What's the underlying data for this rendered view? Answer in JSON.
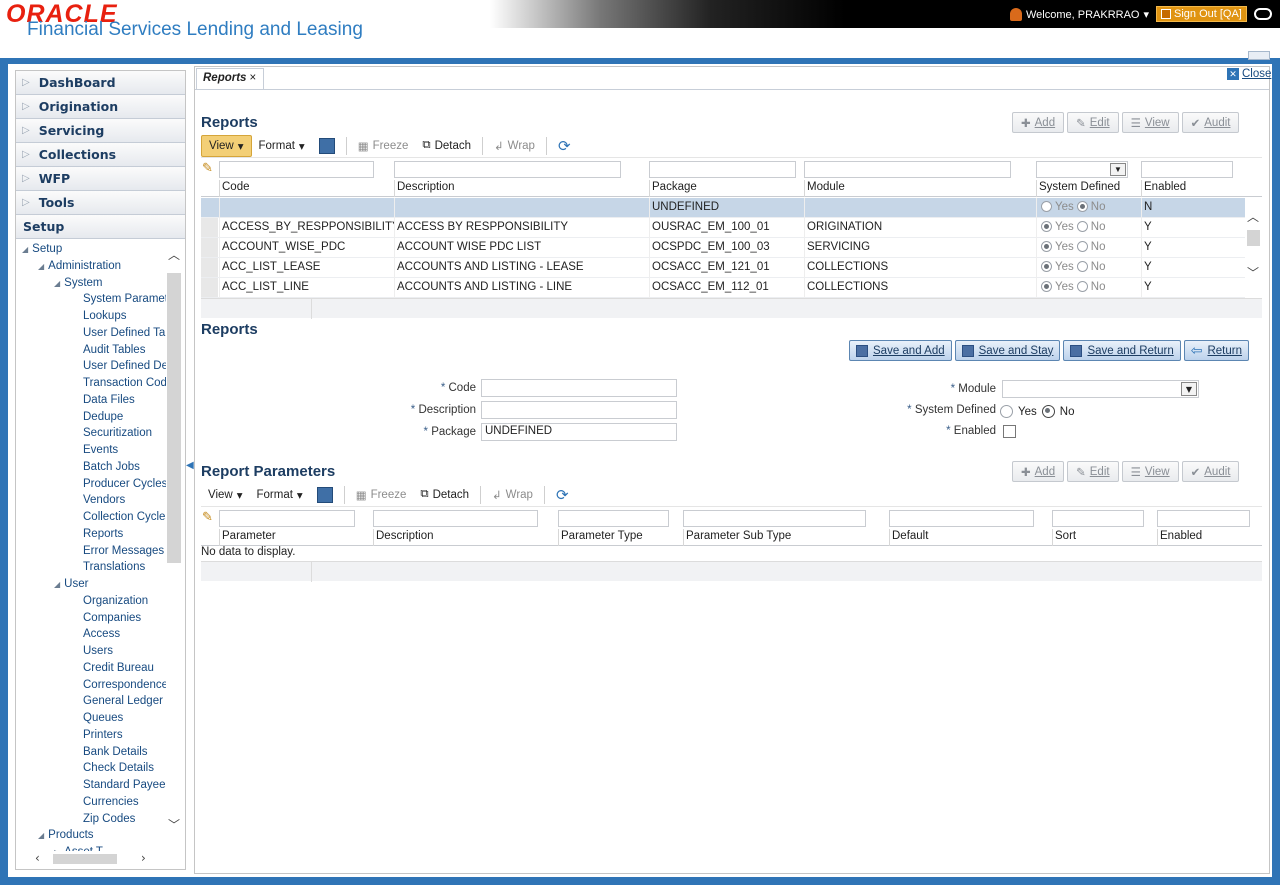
{
  "header": {
    "logo": "ORACLE",
    "product": "Financial Services Lending and Leasing",
    "welcome": "Welcome, PRAKRRAO",
    "signout": "Sign Out [QA]"
  },
  "sidebar": {
    "accordions": [
      "DashBoard",
      "Origination",
      "Servicing",
      "Collections",
      "WFP",
      "Tools"
    ],
    "active_accordion": "Setup",
    "tree": [
      {
        "label": "Setup",
        "level": 0,
        "expanded": true
      },
      {
        "label": "Administration",
        "level": 1,
        "expanded": true
      },
      {
        "label": "System",
        "level": 2,
        "expanded": true
      },
      {
        "label": "System Paramete",
        "level": 3
      },
      {
        "label": "Lookups",
        "level": 3
      },
      {
        "label": "User Defined Tab",
        "level": 3
      },
      {
        "label": "Audit Tables",
        "level": 3
      },
      {
        "label": "User Defined Def",
        "level": 3
      },
      {
        "label": "Transaction Code",
        "level": 3
      },
      {
        "label": "Data Files",
        "level": 3
      },
      {
        "label": "Dedupe",
        "level": 3
      },
      {
        "label": "Securitization",
        "level": 3
      },
      {
        "label": "Events",
        "level": 3
      },
      {
        "label": "Batch Jobs",
        "level": 3
      },
      {
        "label": "Producer Cycles",
        "level": 3
      },
      {
        "label": "Vendors",
        "level": 3
      },
      {
        "label": "Collection Cycles",
        "level": 3
      },
      {
        "label": "Reports",
        "level": 3
      },
      {
        "label": "Error Messages",
        "level": 3
      },
      {
        "label": "Translations",
        "level": 3
      },
      {
        "label": "User",
        "level": 2,
        "expanded": true
      },
      {
        "label": "Organization",
        "level": 3
      },
      {
        "label": "Companies",
        "level": 3
      },
      {
        "label": "Access",
        "level": 3
      },
      {
        "label": "Users",
        "level": 3
      },
      {
        "label": "Credit Bureau",
        "level": 3
      },
      {
        "label": "Correspondence",
        "level": 3
      },
      {
        "label": "General Ledger",
        "level": 3
      },
      {
        "label": "Queues",
        "level": 3
      },
      {
        "label": "Printers",
        "level": 3
      },
      {
        "label": "Bank Details",
        "level": 3
      },
      {
        "label": "Check Details",
        "level": 3
      },
      {
        "label": "Standard Payees",
        "level": 3
      },
      {
        "label": "Currencies",
        "level": 3
      },
      {
        "label": "Zip Codes",
        "level": 3
      },
      {
        "label": "Products",
        "level": 1,
        "expanded": true
      },
      {
        "label": "Asset T...",
        "level": 2
      }
    ]
  },
  "tab": {
    "label": "Reports",
    "close": "×"
  },
  "close_link": "Close",
  "reports": {
    "title": "Reports",
    "actions": [
      "Add",
      "Edit",
      "View",
      "Audit"
    ],
    "toolbar": {
      "view": "View",
      "format": "Format",
      "freeze": "Freeze",
      "detach": "Detach",
      "wrap": "Wrap"
    },
    "columns": [
      "Code",
      "Description",
      "Package",
      "Module",
      "System Defined",
      "Enabled"
    ],
    "rows": [
      {
        "code": "",
        "description": "",
        "package": "UNDEFINED",
        "module": "",
        "system_defined": "No",
        "enabled": "N"
      },
      {
        "code": "ACCESS_BY_RESPPONSIBILITY",
        "description": "ACCESS BY RESPPONSIBILITY",
        "package": "OUSRAC_EM_100_01",
        "module": "ORIGINATION",
        "system_defined": "Yes",
        "enabled": "Y"
      },
      {
        "code": "ACCOUNT_WISE_PDC",
        "description": "ACCOUNT WISE PDC LIST",
        "package": "OCSPDC_EM_100_03",
        "module": "SERVICING",
        "system_defined": "Yes",
        "enabled": "Y"
      },
      {
        "code": "ACC_LIST_LEASE",
        "description": "ACCOUNTS AND LISTING - LEASE",
        "package": "OCSACC_EM_121_01",
        "module": "COLLECTIONS",
        "system_defined": "Yes",
        "enabled": "Y"
      },
      {
        "code": "ACC_LIST_LINE",
        "description": "ACCOUNTS AND LISTING - LINE",
        "package": "OCSACC_EM_112_01",
        "module": "COLLECTIONS",
        "system_defined": "Yes",
        "enabled": "Y"
      }
    ],
    "yes": "Yes",
    "no": "No"
  },
  "form": {
    "title": "Reports",
    "buttons": [
      "Save and Add",
      "Save and Stay",
      "Save and Return",
      "Return"
    ],
    "code_label": "Code",
    "description_label": "Description",
    "package_label": "Package",
    "package_value": "UNDEFINED",
    "module_label": "Module",
    "system_defined_label": "System Defined",
    "enabled_label": "Enabled",
    "yes": "Yes",
    "no": "No",
    "required_mark": "*"
  },
  "params": {
    "title": "Report Parameters",
    "actions": [
      "Add",
      "Edit",
      "View",
      "Audit"
    ],
    "toolbar": {
      "view": "View",
      "format": "Format",
      "freeze": "Freeze",
      "detach": "Detach",
      "wrap": "Wrap"
    },
    "columns": [
      "Parameter",
      "Description",
      "Parameter Type",
      "Parameter Sub Type",
      "Default",
      "Sort",
      "Enabled"
    ],
    "empty": "No data to display."
  }
}
